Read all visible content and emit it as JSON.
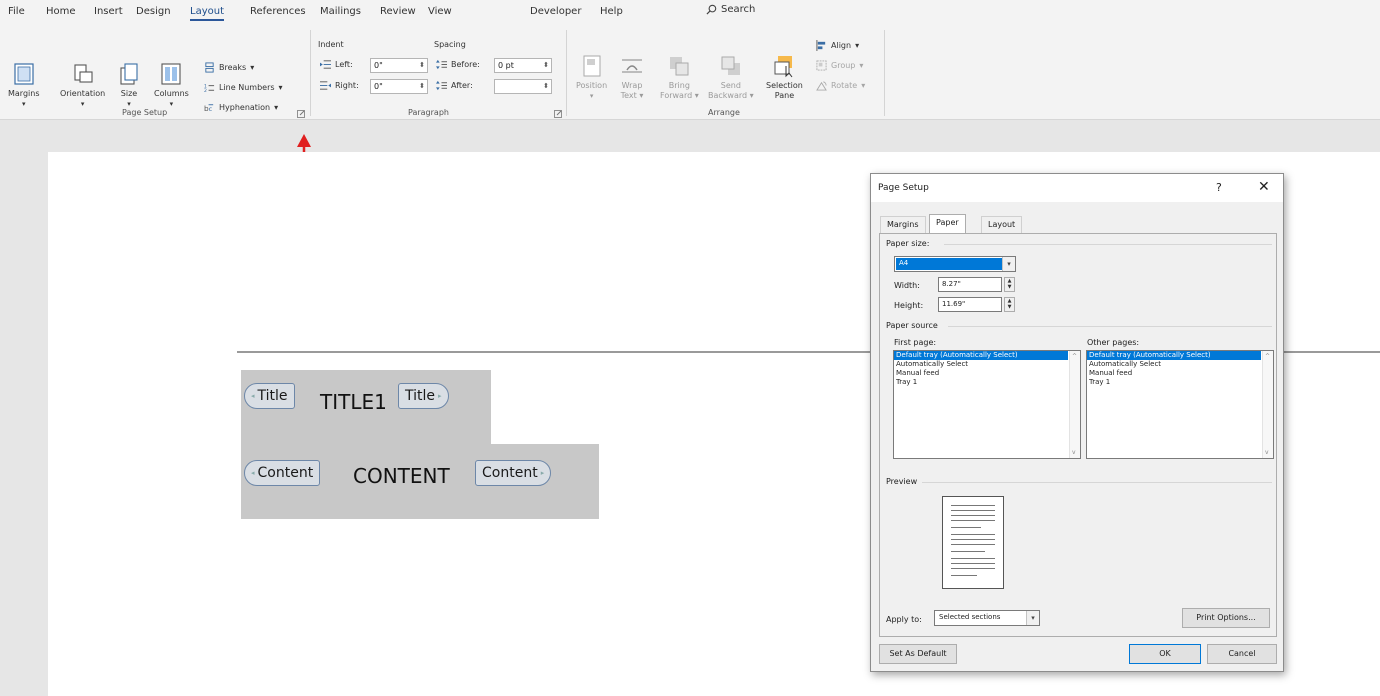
{
  "menu": {
    "tabs": [
      "File",
      "Home",
      "Insert",
      "Design",
      "Layout",
      "References",
      "Mailings",
      "Review",
      "View",
      "Developer",
      "Help"
    ],
    "active_tab": "Layout",
    "search_label": "Search"
  },
  "ribbon": {
    "page_setup": {
      "margins": "Margins",
      "orientation": "Orientation",
      "size": "Size",
      "columns": "Columns",
      "breaks": "Breaks",
      "line_numbers": "Line Numbers",
      "hyphenation": "Hyphenation",
      "group_label": "Page Setup"
    },
    "paragraph": {
      "indent_label": "Indent",
      "spacing_label": "Spacing",
      "left_label": "Left:",
      "left_value": "0\"",
      "right_label": "Right:",
      "right_value": "0\"",
      "before_label": "Before:",
      "before_value": "0 pt",
      "after_label": "After:",
      "after_value": "",
      "group_label": "Paragraph"
    },
    "arrange": {
      "position": "Position",
      "wrap_text_1": "Wrap",
      "wrap_text_2": "Text",
      "bring_forward_1": "Bring",
      "bring_forward_2": "Forward",
      "send_backward_1": "Send",
      "send_backward_2": "Backward",
      "selection_pane_1": "Selection",
      "selection_pane_2": "Pane",
      "align": "Align",
      "group": "Group",
      "rotate": "Rotate",
      "group_label": "Arrange"
    }
  },
  "document": {
    "title_tag": "Title",
    "title_text": "TITLE1",
    "content_tag": "Content",
    "content_text": "CONTENT"
  },
  "dialog": {
    "title": "Page Setup",
    "help": "?",
    "close": "✕",
    "tabs": [
      "Margins",
      "Paper",
      "Layout"
    ],
    "active_tab": "Paper",
    "paper_size_label": "Paper size:",
    "paper_size_value": "A4",
    "width_label": "Width:",
    "width_value": "8.27\"",
    "height_label": "Height:",
    "height_value": "11.69\"",
    "paper_source_label": "Paper source",
    "first_page_label": "First page:",
    "other_pages_label": "Other pages:",
    "first_page_options": [
      "Default tray (Automatically Select)",
      "Automatically Select",
      "Manual feed",
      "Tray 1"
    ],
    "other_pages_options": [
      "Default tray (Automatically Select)",
      "Automatically Select",
      "Manual feed",
      "Tray 1"
    ],
    "preview_label": "Preview",
    "apply_to_label": "Apply to:",
    "apply_to_value": "Selected sections",
    "print_options": "Print Options...",
    "set_as_default": "Set As Default",
    "ok": "OK",
    "cancel": "Cancel"
  },
  "colors": {
    "accent": "#2b579a",
    "arrow": "#e02020",
    "selection": "#0078d7"
  }
}
